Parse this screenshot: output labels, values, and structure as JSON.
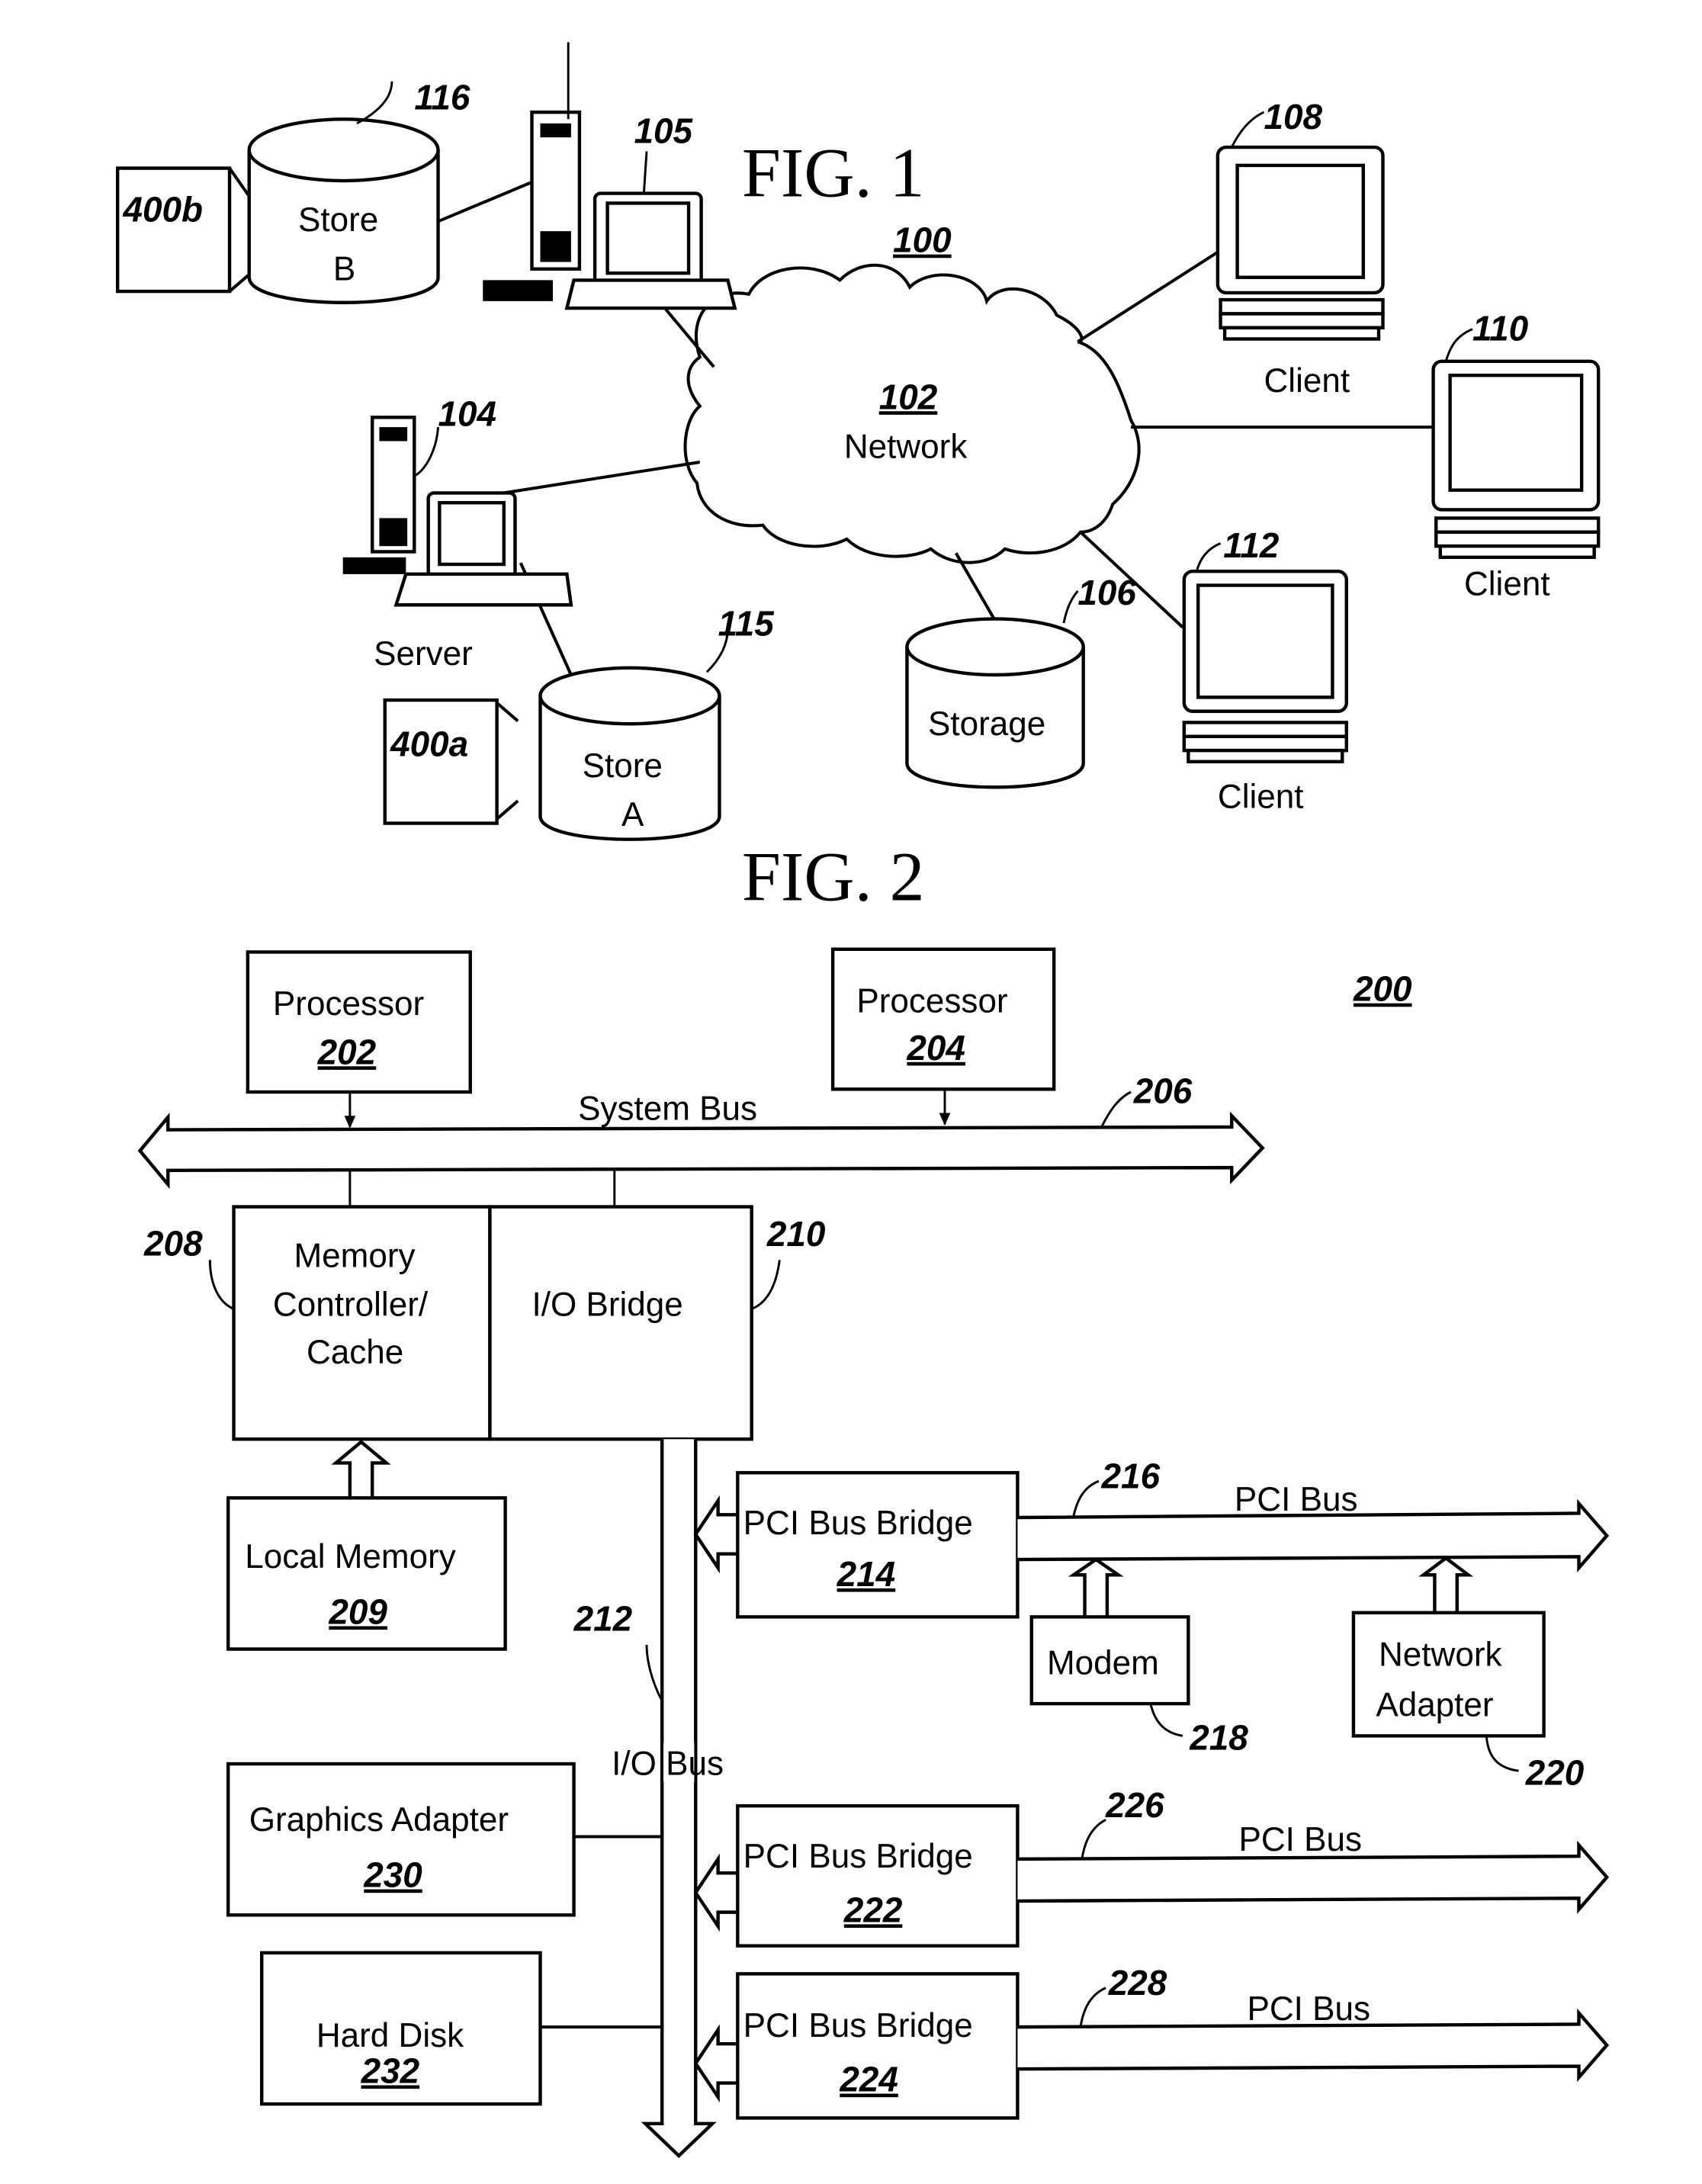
{
  "fig1": {
    "title": "FIG. 1",
    "system_ref": "100",
    "network": {
      "ref": "102",
      "label": "Network"
    },
    "store_b": {
      "ref": "116",
      "line1": "Store",
      "line2": "B",
      "attached_ref": "400b"
    },
    "store_a": {
      "ref": "115",
      "line1": "Store",
      "line2": "A",
      "attached_ref": "400a"
    },
    "workstation": {
      "ref": "105"
    },
    "server": {
      "ref": "104",
      "label": "Server"
    },
    "storage": {
      "ref": "106",
      "label": "Storage"
    },
    "clients": [
      {
        "ref": "108",
        "label": "Client"
      },
      {
        "ref": "110",
        "label": "Client"
      },
      {
        "ref": "112",
        "label": "Client"
      }
    ]
  },
  "fig2": {
    "title": "FIG. 2",
    "system_ref": "200",
    "processors": [
      {
        "label": "Processor",
        "ref": "202"
      },
      {
        "label": "Processor",
        "ref": "204"
      }
    ],
    "system_bus": {
      "label": "System Bus",
      "ref": "206"
    },
    "memory_controller": {
      "line1": "Memory",
      "line2": "Controller/",
      "line3": "Cache",
      "ref": "208"
    },
    "io_bridge": {
      "label": "I/O Bridge",
      "ref": "210"
    },
    "local_memory": {
      "label": "Local Memory",
      "ref": "209"
    },
    "io_bus": {
      "label": "I/O Bus",
      "ref": "212"
    },
    "pci_bridges": [
      {
        "label": "PCI Bus Bridge",
        "ref": "214",
        "bus_label": "PCI Bus",
        "bus_ref": "216"
      },
      {
        "label": "PCI Bus Bridge",
        "ref": "222",
        "bus_label": "PCI Bus",
        "bus_ref": "226"
      },
      {
        "label": "PCI Bus Bridge",
        "ref": "224",
        "bus_label": "PCI Bus",
        "bus_ref": "228"
      }
    ],
    "modem": {
      "label": "Modem",
      "ref": "218"
    },
    "network_adapter": {
      "line1": "Network",
      "line2": "Adapter",
      "ref": "220"
    },
    "graphics_adapter": {
      "label": "Graphics Adapter",
      "ref": "230"
    },
    "hard_disk": {
      "label": "Hard Disk",
      "ref": "232"
    }
  }
}
